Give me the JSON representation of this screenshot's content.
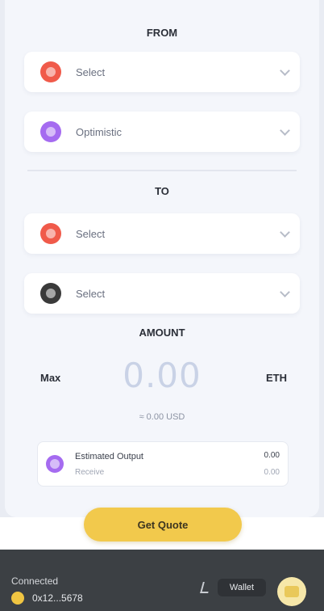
{
  "from": {
    "title": "FROM",
    "rows": [
      {
        "label": "Select",
        "icon": "network-icon",
        "color": "#f05a4a"
      },
      {
        "label": "Optimistic",
        "icon": "token-icon",
        "color": "#a56bf0"
      }
    ]
  },
  "to": {
    "title": "TO",
    "rows": [
      {
        "label": "Select",
        "icon": "network-icon",
        "color": "#f05a4a"
      },
      {
        "label": "Select",
        "icon": "token-icon",
        "color": "#3a3a3a"
      }
    ]
  },
  "amount": {
    "title": "AMOUNT",
    "left_label": "Max",
    "value": "0.00",
    "right_label": "ETH",
    "usd": "≈ 0.00 USD"
  },
  "quote": {
    "name": "Estimated Output",
    "sub": "Receive",
    "value": "0.00",
    "value_sub": "0.00"
  },
  "cta": {
    "label": "Get Quote"
  },
  "footer": {
    "title": "Connected",
    "address": "0x12...5678",
    "wallet_label": "Wallet"
  },
  "colors": {
    "accent": "#f2c94c",
    "footer_bg": "#3c4044"
  }
}
